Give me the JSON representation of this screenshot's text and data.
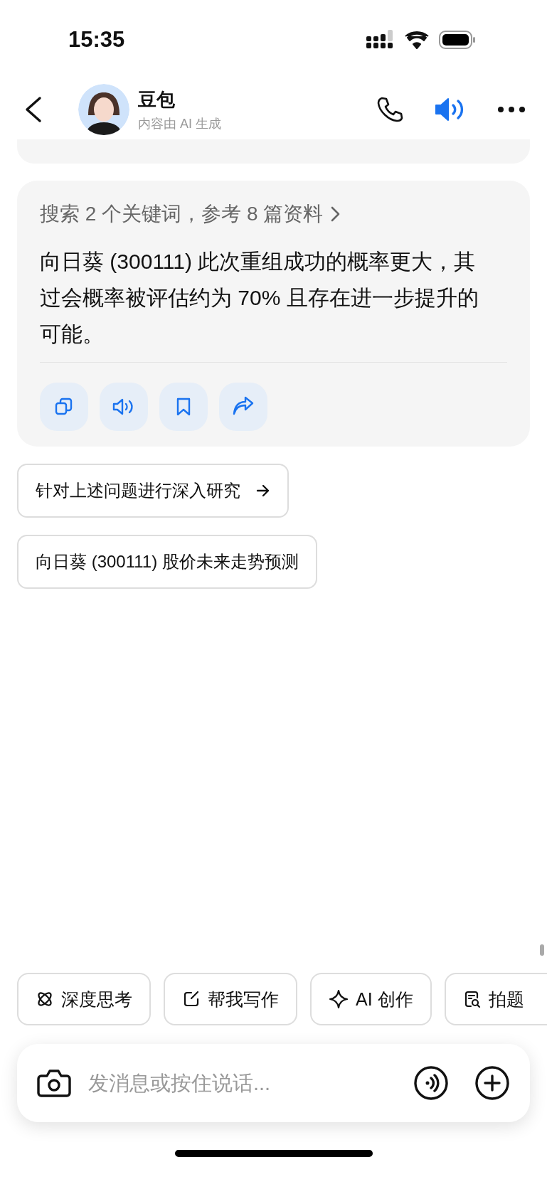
{
  "status_bar": {
    "time": "15:35"
  },
  "header": {
    "title": "豆包",
    "subtitle": "内容由 AI 生成"
  },
  "message": {
    "sources": "搜索 2 个关键词，参考 8 篇资料",
    "text": "向日葵 (300111) 此次重组成功的概率更大，其过会概率被评估约为 70% 且存在进一步提升的可能。",
    "actions": [
      {
        "kind": "copy"
      },
      {
        "kind": "speak"
      },
      {
        "kind": "bookmark"
      },
      {
        "kind": "share"
      }
    ]
  },
  "suggestions": [
    {
      "label": "针对上述问题进行深入研究",
      "kind": "arrow"
    },
    {
      "label": "向日葵 (300111) 股价未来走势预测",
      "kind": "plain"
    }
  ],
  "tools": [
    {
      "kind": "think",
      "label": "深度思考"
    },
    {
      "kind": "write",
      "label": "帮我写作"
    },
    {
      "kind": "sparkle",
      "label": "AI 创作"
    },
    {
      "kind": "scan",
      "label": "拍题"
    }
  ],
  "input": {
    "placeholder": "发消息或按住说话..."
  }
}
